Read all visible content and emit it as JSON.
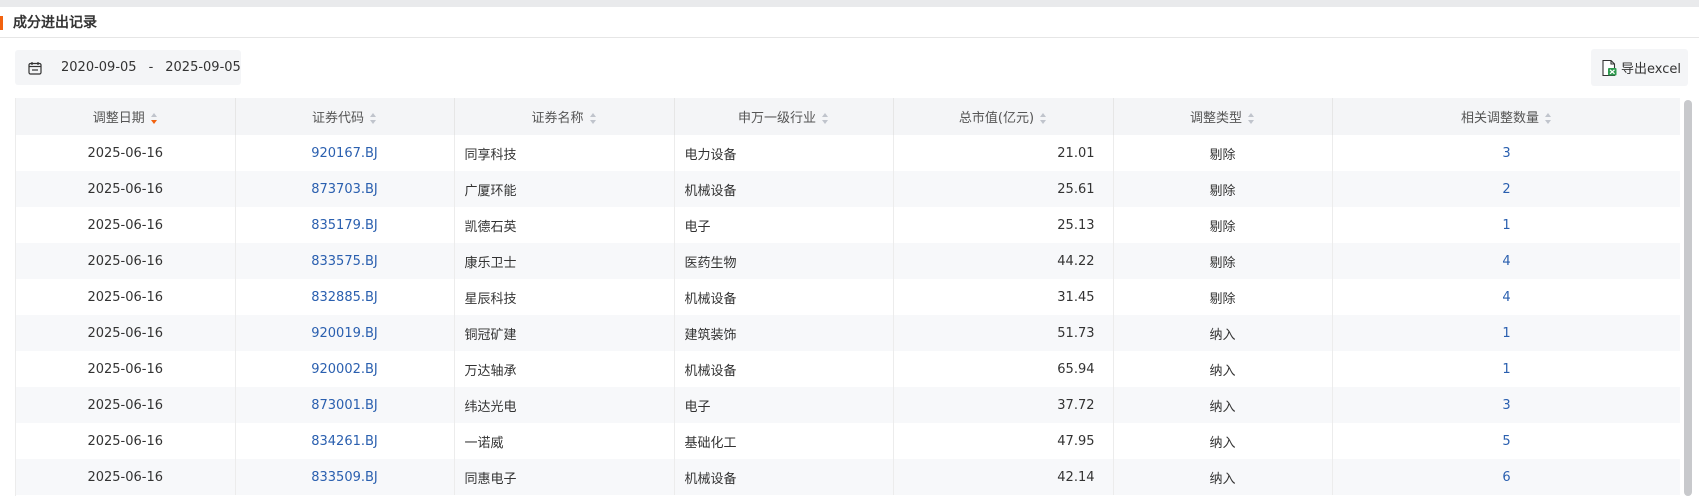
{
  "section": {
    "title": "成分进出记录"
  },
  "filter": {
    "start_date": "2020-09-05",
    "separator": "-",
    "end_date": "2025-09-05",
    "calendar_icon": "calendar-icon"
  },
  "export": {
    "label": "导出excel",
    "icon": "excel-icon"
  },
  "colors": {
    "accent": "#f2620f",
    "link": "#2a5faf",
    "header_bg": "#f4f5f7"
  },
  "table": {
    "columns": [
      "调整日期",
      "证券代码",
      "证券名称",
      "申万一级行业",
      "总市值(亿元)",
      "调整类型",
      "相关调整数量"
    ],
    "sorted_column": "调整日期",
    "rows": [
      {
        "date": "2025-06-16",
        "code": "920167.BJ",
        "name": "同享科技",
        "industry": "电力设备",
        "market_cap": "21.01",
        "type": "剔除",
        "count": "3"
      },
      {
        "date": "2025-06-16",
        "code": "873703.BJ",
        "name": "广厦环能",
        "industry": "机械设备",
        "market_cap": "25.61",
        "type": "剔除",
        "count": "2"
      },
      {
        "date": "2025-06-16",
        "code": "835179.BJ",
        "name": "凯德石英",
        "industry": "电子",
        "market_cap": "25.13",
        "type": "剔除",
        "count": "1"
      },
      {
        "date": "2025-06-16",
        "code": "833575.BJ",
        "name": "康乐卫士",
        "industry": "医药生物",
        "market_cap": "44.22",
        "type": "剔除",
        "count": "4"
      },
      {
        "date": "2025-06-16",
        "code": "832885.BJ",
        "name": "星辰科技",
        "industry": "机械设备",
        "market_cap": "31.45",
        "type": "剔除",
        "count": "4"
      },
      {
        "date": "2025-06-16",
        "code": "920019.BJ",
        "name": "铜冠矿建",
        "industry": "建筑装饰",
        "market_cap": "51.73",
        "type": "纳入",
        "count": "1"
      },
      {
        "date": "2025-06-16",
        "code": "920002.BJ",
        "name": "万达轴承",
        "industry": "机械设备",
        "market_cap": "65.94",
        "type": "纳入",
        "count": "1"
      },
      {
        "date": "2025-06-16",
        "code": "873001.BJ",
        "name": "纬达光电",
        "industry": "电子",
        "market_cap": "37.72",
        "type": "纳入",
        "count": "3"
      },
      {
        "date": "2025-06-16",
        "code": "834261.BJ",
        "name": "一诺威",
        "industry": "基础化工",
        "market_cap": "47.95",
        "type": "纳入",
        "count": "5"
      },
      {
        "date": "2025-06-16",
        "code": "833509.BJ",
        "name": "同惠电子",
        "industry": "机械设备",
        "market_cap": "42.14",
        "type": "纳入",
        "count": "6"
      }
    ]
  }
}
